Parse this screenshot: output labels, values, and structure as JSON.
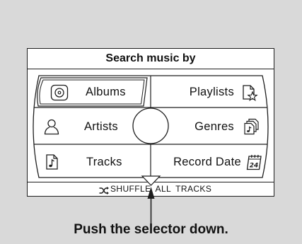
{
  "panel": {
    "title": "Search music by"
  },
  "menu": {
    "left": [
      {
        "label": "Albums",
        "icon": "disc-icon",
        "selected": true
      },
      {
        "label": "Artists",
        "icon": "person-icon",
        "selected": false
      },
      {
        "label": "Tracks",
        "icon": "music-file-icon",
        "selected": false
      }
    ],
    "right": [
      {
        "label": "Playlists",
        "icon": "playlist-star-icon",
        "selected": false
      },
      {
        "label": "Genres",
        "icon": "genre-files-icon",
        "selected": false
      },
      {
        "label": "Record Date",
        "icon": "calendar-icon",
        "icon_text": "24",
        "selected": false
      }
    ]
  },
  "footer": {
    "label": "SHUFFLE ALL TRACKS",
    "icon": "shuffle-icon"
  },
  "caption": "Push the selector down.",
  "colors": {
    "background": "#d9d9d9",
    "panel": "#ffffff",
    "line": "#1e1e1e",
    "text": "#111111"
  }
}
